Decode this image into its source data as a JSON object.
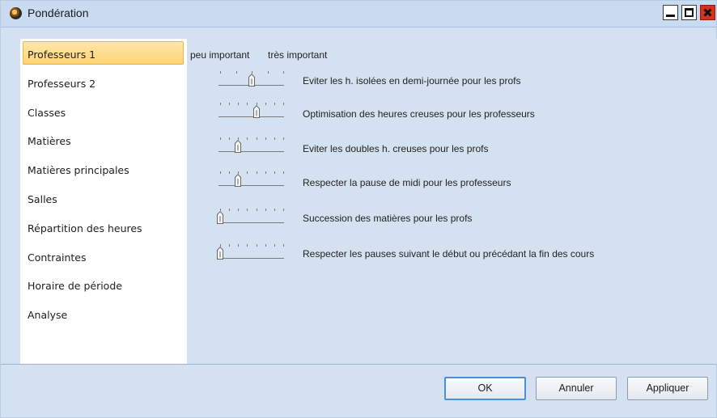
{
  "window": {
    "title": "Pondération",
    "controls": {
      "minimize": "minimize",
      "maximize": "maximize",
      "close": "close"
    }
  },
  "sidebar": {
    "items": [
      {
        "label": "Professeurs 1",
        "active": true
      },
      {
        "label": "Professeurs 2",
        "active": false
      },
      {
        "label": "Classes",
        "active": false
      },
      {
        "label": "Matières",
        "active": false
      },
      {
        "label": "Matières principales",
        "active": false
      },
      {
        "label": "Salles",
        "active": false
      },
      {
        "label": "Répartition des heures",
        "active": false
      },
      {
        "label": "Contraintes",
        "active": false
      },
      {
        "label": "Horaire de période",
        "active": false
      },
      {
        "label": "Analyse",
        "active": false
      }
    ]
  },
  "content": {
    "legend_low": "peu important",
    "legend_high": "très important",
    "preferences": [
      {
        "label": "Eviter les h. isolées en demi-journée pour les profs",
        "level": 2,
        "max": 4
      },
      {
        "label": "Optimisation des heures creuses pour les professeurs",
        "level": 4,
        "max": 7
      },
      {
        "label": "Eviter les doubles h. creuses pour les profs",
        "level": 2,
        "max": 7
      },
      {
        "label": "Respecter la pause de midi pour les professeurs",
        "level": 2,
        "max": 7
      },
      {
        "label": "Succession des matières pour les profs",
        "level": 0,
        "max": 7
      },
      {
        "label": "Respecter les pauses suivant le début ou précédant la fin des cours",
        "level": 0,
        "max": 7
      }
    ]
  },
  "footer": {
    "ok_label": "OK",
    "cancel_label": "Annuler",
    "apply_label": "Appliquer"
  },
  "colors": {
    "panel_bg": "#d4e1f1",
    "active_item_bg": "#ffd476",
    "close_button": "#d9301c",
    "default_button_border": "#4a90d9"
  }
}
